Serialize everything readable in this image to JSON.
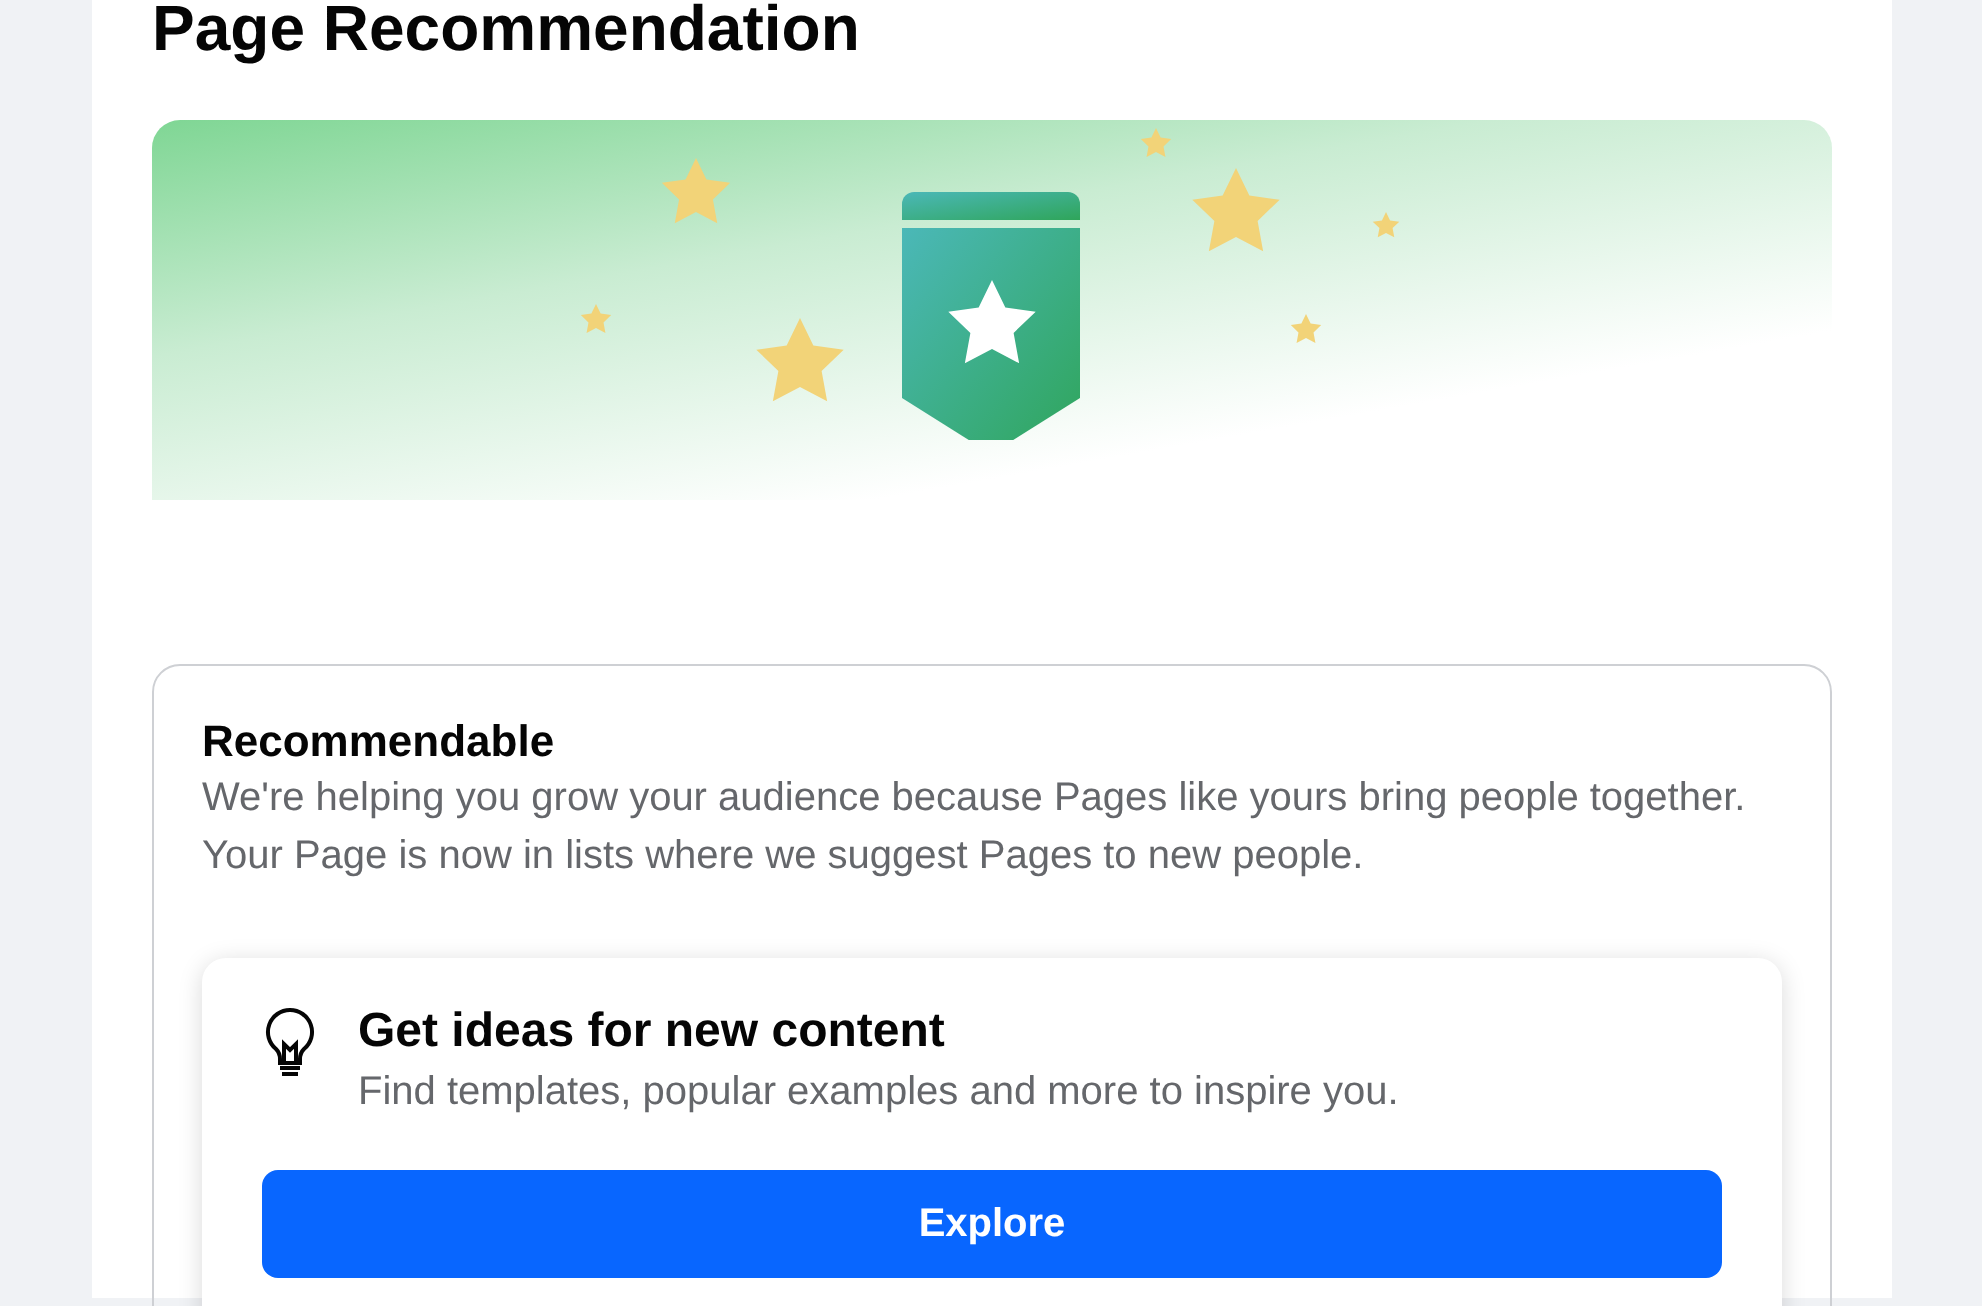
{
  "title": "Page Recommendation",
  "status_card": {
    "heading": "Recommendable",
    "description": "We're helping you grow your audience because Pages like yours bring people together. Your Page is now in lists where we suggest Pages to new people."
  },
  "idea_card": {
    "heading": "Get ideas for new content",
    "description": "Find templates, popular examples and more to inspire you.",
    "button": "Explore"
  }
}
